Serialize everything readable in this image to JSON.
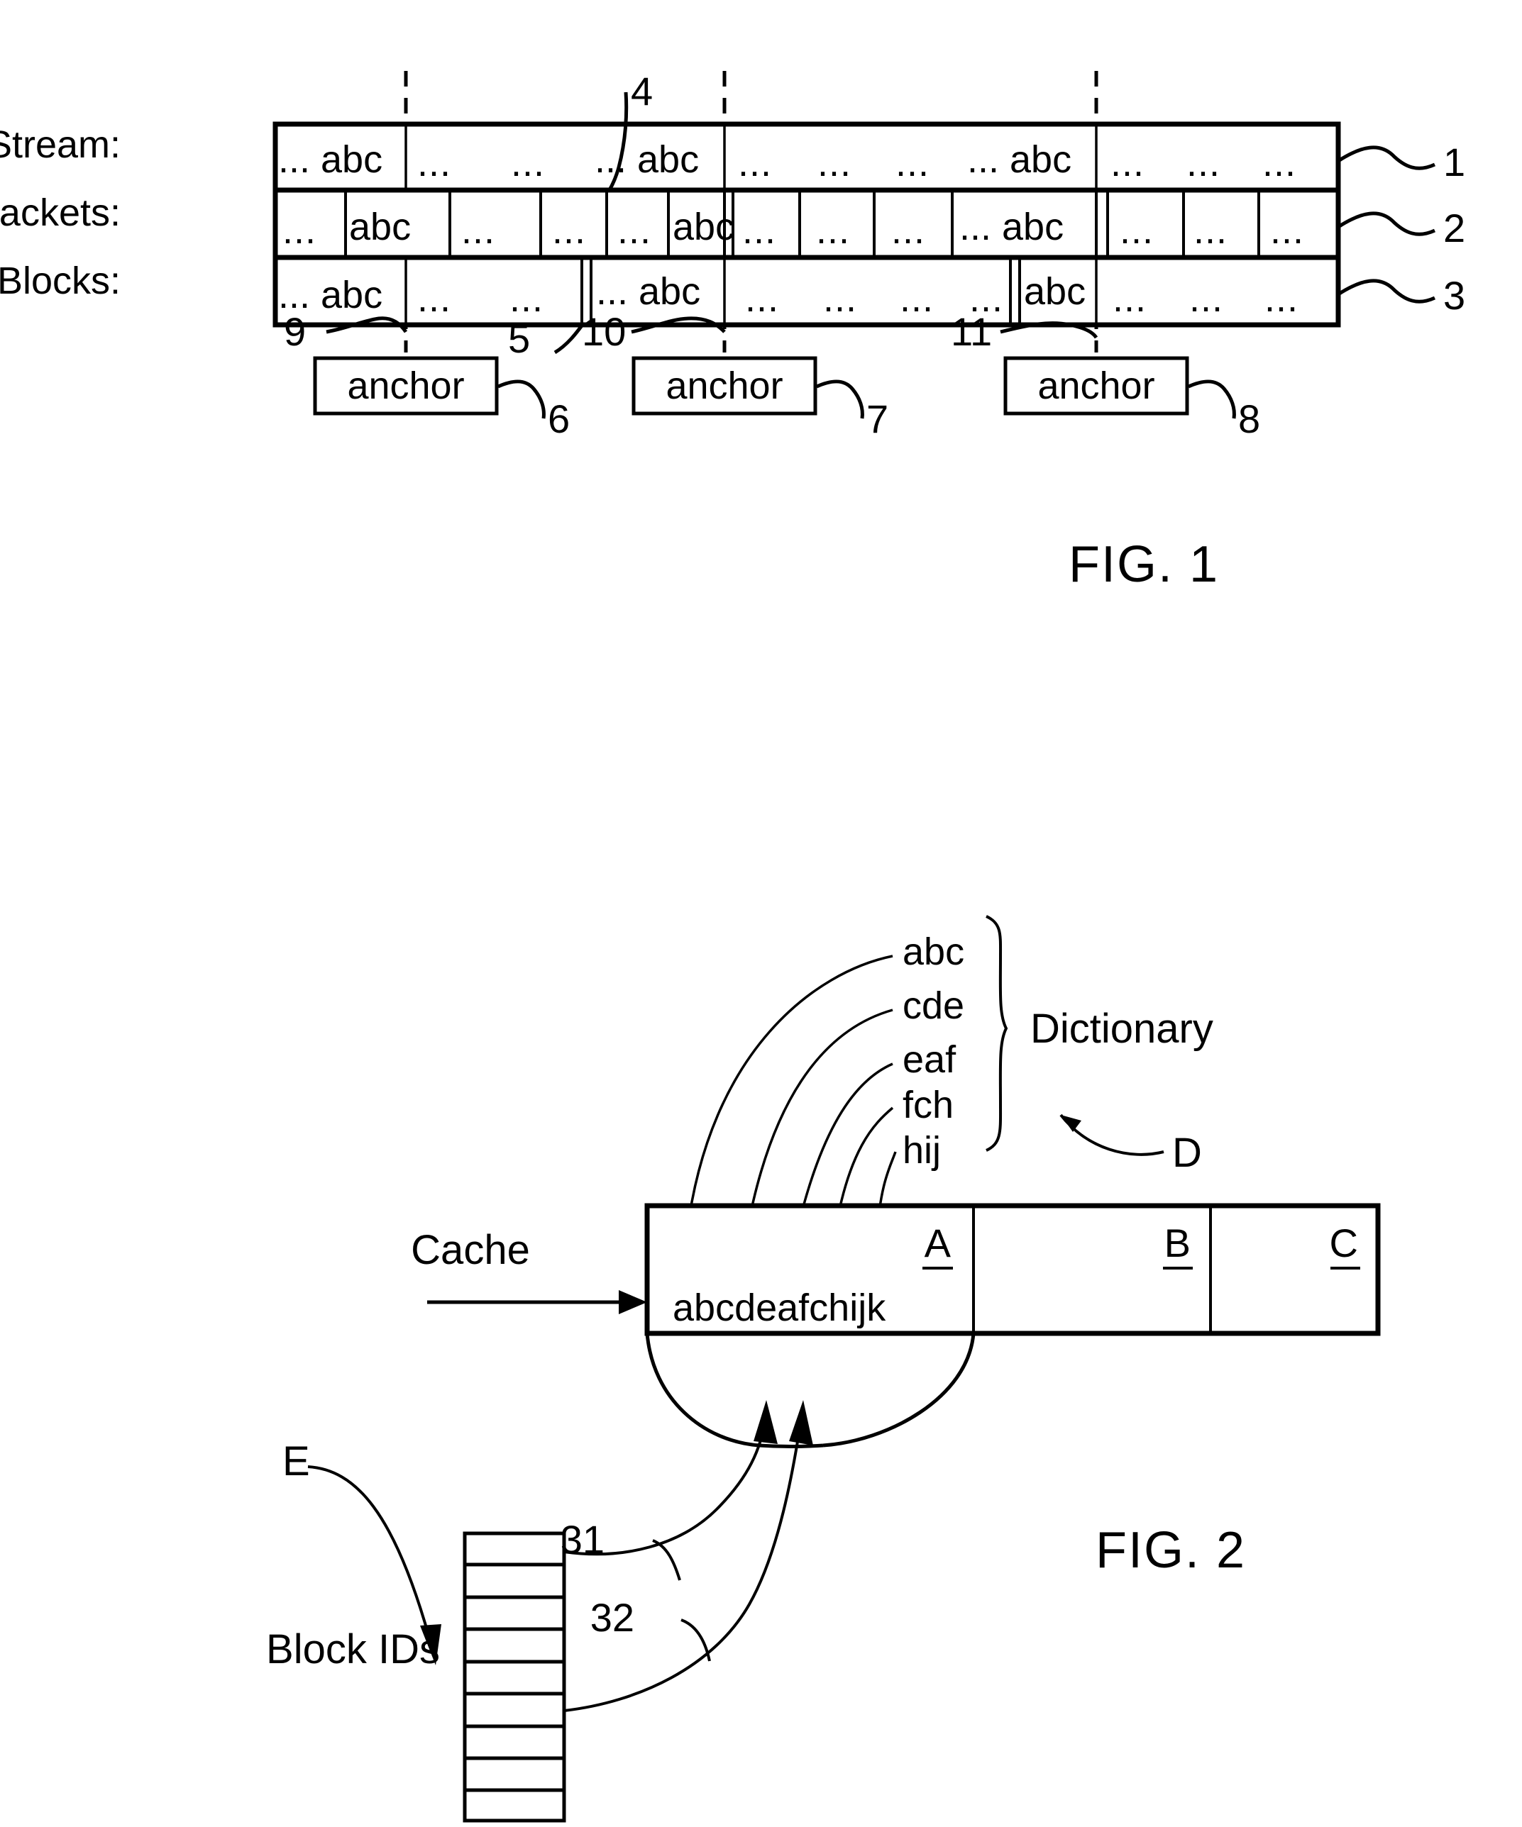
{
  "figure1": {
    "title": "FIG. 1",
    "rows": [
      {
        "label": "Stream:",
        "ref": "1",
        "cells": [
          "... abc",
          "...",
          "...",
          "... abc",
          "...",
          "...",
          "...",
          "... abc",
          "...",
          "...",
          "..."
        ]
      },
      {
        "label": "Packets:",
        "ref": "2",
        "cells": [
          "...",
          "abc",
          "...",
          "...",
          "...",
          "abc",
          "...",
          "...",
          "...",
          "... abc",
          "...",
          "...",
          "..."
        ]
      },
      {
        "label": "Blocks:",
        "ref": "3",
        "cells": [
          "... abc",
          "...",
          "...",
          "... abc",
          "...",
          "...",
          "...",
          "...",
          "abc",
          "...",
          "...",
          "..."
        ]
      }
    ],
    "callouts": [
      {
        "id": "c4",
        "text": "4"
      },
      {
        "id": "c9",
        "text": "9"
      },
      {
        "id": "c5",
        "text": "5"
      },
      {
        "id": "c10",
        "text": "10"
      },
      {
        "id": "c11",
        "text": "11"
      },
      {
        "id": "c6",
        "text": "6"
      },
      {
        "id": "c7",
        "text": "7"
      },
      {
        "id": "c8",
        "text": "8"
      }
    ],
    "anchors": [
      {
        "label": "anchor",
        "ref": "6"
      },
      {
        "label": "anchor",
        "ref": "7"
      },
      {
        "label": "anchor",
        "ref": "8"
      }
    ]
  },
  "figure2": {
    "title": "FIG. 2",
    "dictionary": {
      "label": "Dictionary",
      "ref": "D",
      "words": [
        "abc",
        "cde",
        "eaf",
        "fch",
        "hij"
      ]
    },
    "cache": {
      "label": "Cache",
      "slots": [
        {
          "letter": "A",
          "content": "abcdeafchijk"
        },
        {
          "letter": "B",
          "content": ""
        },
        {
          "letter": "C",
          "content": ""
        }
      ]
    },
    "block_ids": {
      "label": "Block IDs",
      "ref": "E",
      "pointers": [
        "31",
        "32"
      ],
      "cell_count": 9
    }
  },
  "colors": {
    "ink": "#000000",
    "paper": "#ffffff"
  }
}
